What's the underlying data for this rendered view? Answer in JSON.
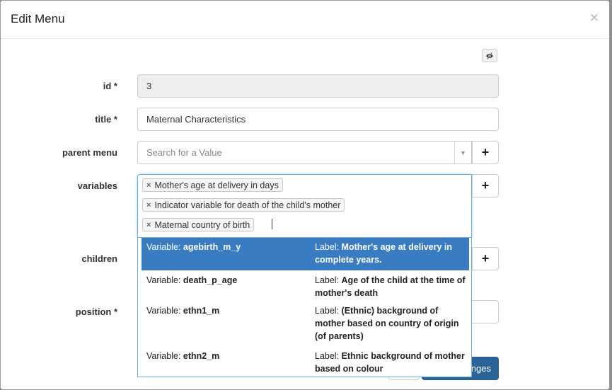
{
  "modal": {
    "title": "Edit Menu",
    "close_glyph": "×"
  },
  "form": {
    "id": {
      "label": "id *",
      "value": "3"
    },
    "title": {
      "label": "title *",
      "value": "Maternal Characteristics"
    },
    "parent_menu": {
      "label": "parent menu",
      "placeholder": "Search for a Value",
      "add_glyph": "+"
    },
    "variables": {
      "label": "variables",
      "add_glyph": "+",
      "selected": [
        "Mother's age at delivery in days",
        "Indicator variable for death of the child's mother",
        "Maternal country of birth"
      ],
      "remove_glyph": "×"
    },
    "children": {
      "label": "children",
      "add_glyph": "+"
    },
    "position": {
      "label": "position *"
    }
  },
  "dropdown": {
    "variable_prefix": "Variable: ",
    "label_prefix": "Label: ",
    "options": [
      {
        "variable": "agebirth_m_y",
        "label": "Mother's age at delivery in complete years."
      },
      {
        "variable": "death_p_age",
        "label": "Age of the child at the time of mother's death"
      },
      {
        "variable": "ethn1_m",
        "label": "(Ethnic) background of mother based on country of origin (of parents)"
      },
      {
        "variable": "ethn2_m",
        "label": "Ethnic background of mother based on colour"
      }
    ]
  },
  "footer": {
    "primary_label": "nges"
  },
  "icons": {
    "eye": "eye-slash-icon",
    "close": "close-icon",
    "caret": "caret-down-icon"
  },
  "colors": {
    "highlight": "#3a7cc2",
    "focus_border": "#66afe9",
    "primary_button": "#2a6496"
  }
}
